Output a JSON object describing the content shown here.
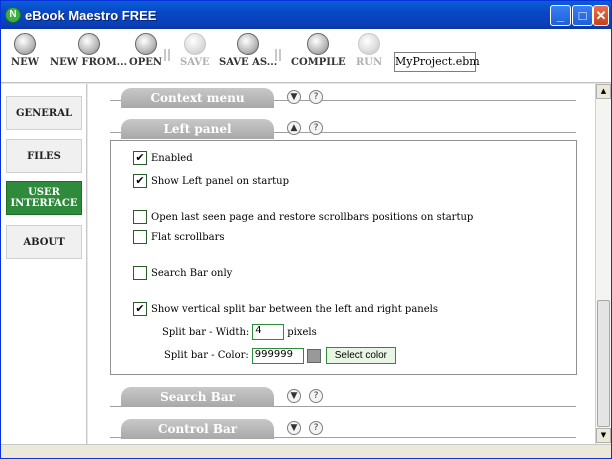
{
  "window": {
    "title": "eBook Maestro FREE",
    "app_icon": "N"
  },
  "toolbar": {
    "buttons": [
      {
        "label": "NEW",
        "icon": "new-icon"
      },
      {
        "label": "NEW FROM...",
        "icon": "new-from-icon"
      },
      {
        "label": "OPEN",
        "icon": "open-icon"
      },
      {
        "label": "SAVE",
        "icon": "save-icon"
      },
      {
        "label": "SAVE AS...",
        "icon": "save-as-icon"
      },
      {
        "label": "COMPILE",
        "icon": "compile-icon"
      },
      {
        "label": "RUN",
        "icon": "run-icon"
      }
    ],
    "project": "MyProject.ebm"
  },
  "nav": {
    "items": [
      {
        "label": "GENERAL"
      },
      {
        "label": "FILES"
      },
      {
        "label": "USER INTERFACE"
      },
      {
        "label": "ABOUT"
      }
    ],
    "active_color": "#2e8b3c"
  },
  "sections": {
    "context_menu": "Context menu",
    "left_panel": "Left panel",
    "search_bar": "Search Bar",
    "control_bar": "Control Bar",
    "help_glyph": "?"
  },
  "left_panel": {
    "options": [
      {
        "label": "Enabled",
        "checked": true
      },
      {
        "label": "Show Left panel on startup",
        "checked": true
      },
      {
        "label": "Open last seen page and restore scrollbars positions on startup",
        "checked": false
      },
      {
        "label": "Flat scrollbars",
        "checked": false
      },
      {
        "label": "Search Bar only",
        "checked": false
      },
      {
        "label": "Show vertical split bar between the left and right panels",
        "checked": true
      }
    ],
    "split_width_label": "Split bar - Width:",
    "split_width_value": "4",
    "split_width_unit": "pixels",
    "split_color_label": "Split bar - Color:",
    "split_color_value": "999999",
    "select_color_label": "Select color"
  }
}
